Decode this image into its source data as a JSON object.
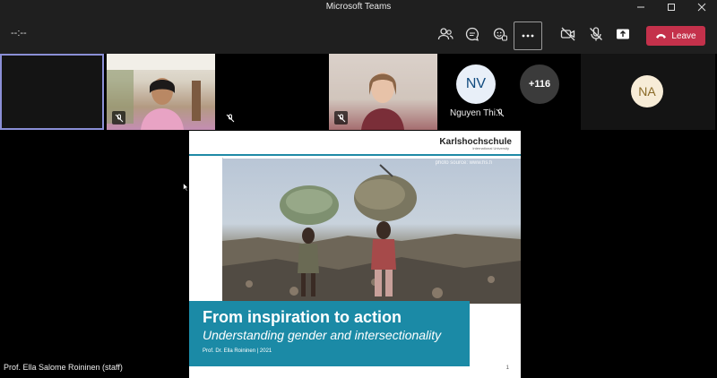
{
  "window": {
    "title": "Microsoft Teams"
  },
  "toolbar": {
    "timer": "--:--",
    "leave_label": "Leave",
    "buttons": [
      "people-icon",
      "chat-icon",
      "reactions-icon",
      "more-icon",
      "camera-off-icon",
      "mic-off-icon",
      "share-icon"
    ]
  },
  "participants": {
    "tiles": [
      {
        "name": "",
        "type": "active-blank"
      },
      {
        "name": "",
        "type": "video-woman-outdoor",
        "muted": true
      },
      {
        "name": "",
        "type": "blank",
        "muted": true
      },
      {
        "name": "",
        "type": "video-woman-indoor",
        "muted": true
      }
    ],
    "avatar_nv_initials": "NV",
    "avatar_nv_name": "Nguyen Thi...",
    "overflow_count": "+116",
    "avatar_na_initials": "NA"
  },
  "slide": {
    "logo": "Karlshochschule",
    "logo_sub": "International University",
    "photo_credit": "photo source: www.hs.fi",
    "title": "From inspiration to action",
    "subtitle": "Understanding gender and intersectionality",
    "author": "Prof. Dr. Ella Roininen | 2021",
    "page_number": "1"
  },
  "presenter": {
    "label": "Prof. Ella Salome Roininen (staff)"
  },
  "colors": {
    "leave": "#c4314b",
    "slide_accent": "#1b8aa6",
    "active_tile_border": "#8b8fd6"
  }
}
